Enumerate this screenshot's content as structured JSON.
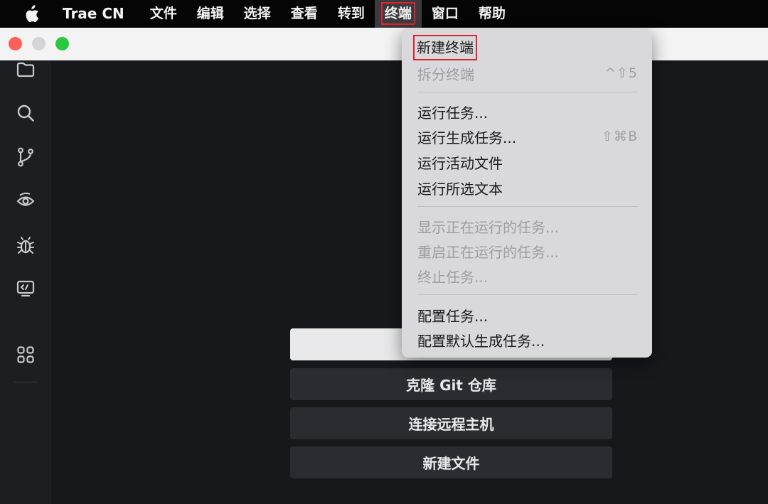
{
  "menubar": {
    "app_name": "Trae CN",
    "items": [
      "文件",
      "编辑",
      "选择",
      "查看",
      "转到",
      "终端",
      "窗口",
      "帮助"
    ],
    "active_item": "终端"
  },
  "window": {
    "traffic_colors": [
      "#fe5f57",
      "#d4d4d6",
      "#28c840"
    ]
  },
  "sidebar": {
    "icons": [
      "folder-icon",
      "search-icon",
      "source-control-icon",
      "ai-eye-icon",
      "debug-icon",
      "remote-icon",
      "extensions-icon"
    ]
  },
  "welcome": {
    "buttons": [
      "",
      "克隆 Git 仓库",
      "连接远程主机",
      "新建文件"
    ]
  },
  "terminal_menu": {
    "items": [
      {
        "label": "新建终端",
        "shortcut": "",
        "enabled": true
      },
      {
        "label": "拆分终端",
        "shortcut": "^⇧5",
        "enabled": false
      },
      {
        "label": "运行任务...",
        "shortcut": "",
        "enabled": true
      },
      {
        "label": "运行生成任务...",
        "shortcut": "⇧⌘B",
        "enabled": false
      },
      {
        "label": "运行活动文件",
        "shortcut": "",
        "enabled": true
      },
      {
        "label": "运行所选文本",
        "shortcut": "",
        "enabled": true
      },
      {
        "label": "显示正在运行的任务...",
        "shortcut": "",
        "enabled": false
      },
      {
        "label": "重启正在运行的任务...",
        "shortcut": "",
        "enabled": false
      },
      {
        "label": "终止任务...",
        "shortcut": "",
        "enabled": false
      },
      {
        "label": "配置任务...",
        "shortcut": "",
        "enabled": true
      },
      {
        "label": "配置默认生成任务...",
        "shortcut": "",
        "enabled": true
      }
    ]
  },
  "colors": {
    "highlight_border": "#e0232a",
    "menubar_bg": "#050505",
    "editor_bg": "#17181c"
  }
}
